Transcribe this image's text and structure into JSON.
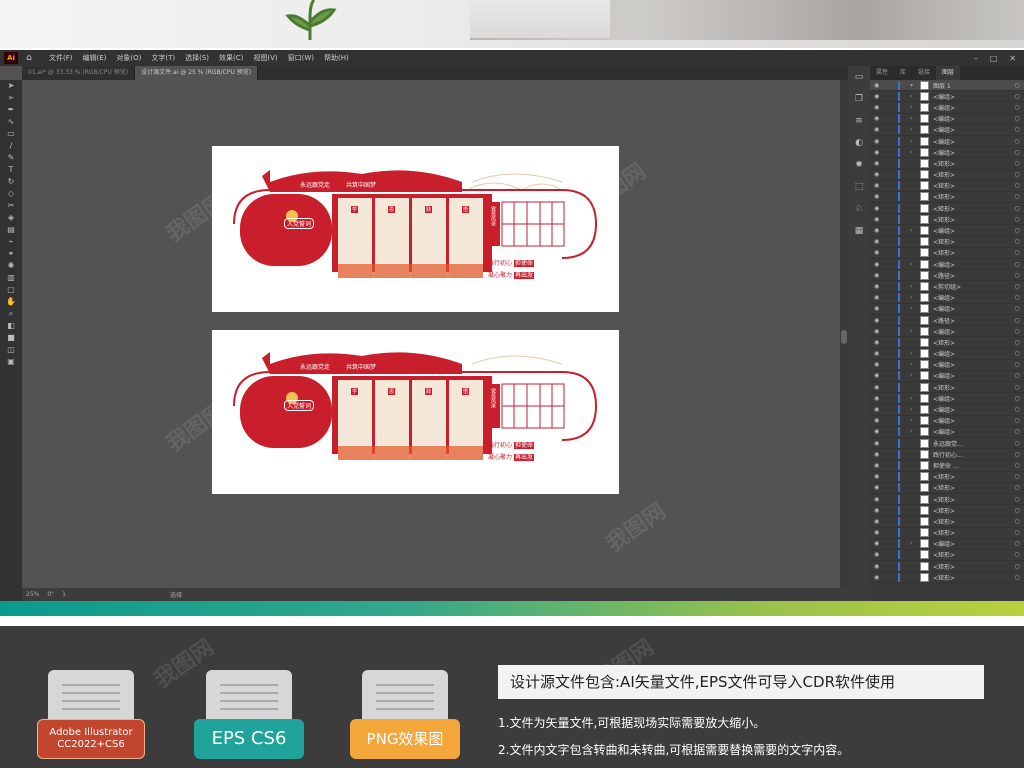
{
  "app": {
    "logo": "Ai",
    "menus": [
      "文件(F)",
      "编辑(E)",
      "对象(O)",
      "文字(T)",
      "选择(S)",
      "效果(C)",
      "视图(V)",
      "窗口(W)",
      "帮助(H)"
    ],
    "tabs": [
      {
        "label": "01.ai* @ 33.33 % (RGB/CPU 预览)",
        "active": false
      },
      {
        "label": "设计源文件.ai @ 25 % (RGB/CPU 预览)",
        "active": true
      }
    ],
    "status": {
      "zoom": "25%",
      "rotation": "0°",
      "artboard": "1",
      "mode": "选择"
    }
  },
  "panel": {
    "tabs": [
      "属性",
      "库",
      "链接",
      "图层"
    ],
    "active_tab": "图层",
    "layers": [
      {
        "name": "图层 1",
        "top": true
      },
      {
        "name": "<编组>",
        "expand": true
      },
      {
        "name": "<编组>",
        "expand": true
      },
      {
        "name": "<编组>",
        "expand": true
      },
      {
        "name": "<编组>",
        "expand": true
      },
      {
        "name": "<编组>",
        "expand": true
      },
      {
        "name": "<编组>",
        "expand": true
      },
      {
        "name": "<矩形>"
      },
      {
        "name": "<矩形>"
      },
      {
        "name": "<矩形>"
      },
      {
        "name": "<矩形>"
      },
      {
        "name": "<矩形>"
      },
      {
        "name": "<矩形>"
      },
      {
        "name": "<编组>",
        "expand": true
      },
      {
        "name": "<矩形>"
      },
      {
        "name": "<矩形>"
      },
      {
        "name": "<编组>",
        "expand": true
      },
      {
        "name": "<路径>"
      },
      {
        "name": "<剪切组>",
        "expand": true
      },
      {
        "name": "<编组>",
        "expand": true
      },
      {
        "name": "<编组>",
        "expand": true
      },
      {
        "name": "<路径>"
      },
      {
        "name": "<编组>",
        "expand": true
      },
      {
        "name": "<矩形>"
      },
      {
        "name": "<编组>",
        "expand": true
      },
      {
        "name": "<编组>",
        "expand": true
      },
      {
        "name": "<编组>",
        "expand": true
      },
      {
        "name": "<矩形>"
      },
      {
        "name": "<编组>",
        "expand": true
      },
      {
        "name": "<编组>",
        "expand": true
      },
      {
        "name": "<编组>",
        "expand": true
      },
      {
        "name": "<编组>",
        "expand": true
      },
      {
        "name": "永远跟党..."
      },
      {
        "name": "践行初心..."
      },
      {
        "name": "担使命 ..."
      },
      {
        "name": "<矩形>"
      },
      {
        "name": "<矩形>"
      },
      {
        "name": "<矩形>"
      },
      {
        "name": "<矩形>"
      },
      {
        "name": "<矩形>"
      },
      {
        "name": "<矩形>"
      },
      {
        "name": "<编组>",
        "expand": true
      },
      {
        "name": "<矩形>"
      },
      {
        "name": "<矩形>"
      },
      {
        "name": "<矩形>"
      }
    ]
  },
  "artboard": {
    "slogan_left": "永远跟党走",
    "slogan_right": "共筑中国梦",
    "oath_title": "入党誓词",
    "panel_titles": [
      "学",
      "思",
      "践",
      "悟"
    ],
    "side_title": "党员风采",
    "motto_1a": "践行初心",
    "motto_1b": "担使命",
    "motto_2a": "凝心聚力",
    "motto_2b": "再出发"
  },
  "watermark": "我图网",
  "formats": [
    {
      "line1": "Adobe Illustrator",
      "line2": "CC2022+CS6",
      "color": "#c2452e"
    },
    {
      "line1": "EPS CS6",
      "line2": "",
      "color": "#1fa39a"
    },
    {
      "line1": "PNG效果图",
      "line2": "",
      "color": "#f3a63a"
    }
  ],
  "info": {
    "headline": "设计源文件包含:AI矢量文件,EPS文件可导入CDR软件使用",
    "note1": "1.文件为矢量文件,可根据现场实际需要放大缩小。",
    "note2": "2.文件内文字包含转曲和未转曲,可根据需要替换需要的文字内容。"
  }
}
